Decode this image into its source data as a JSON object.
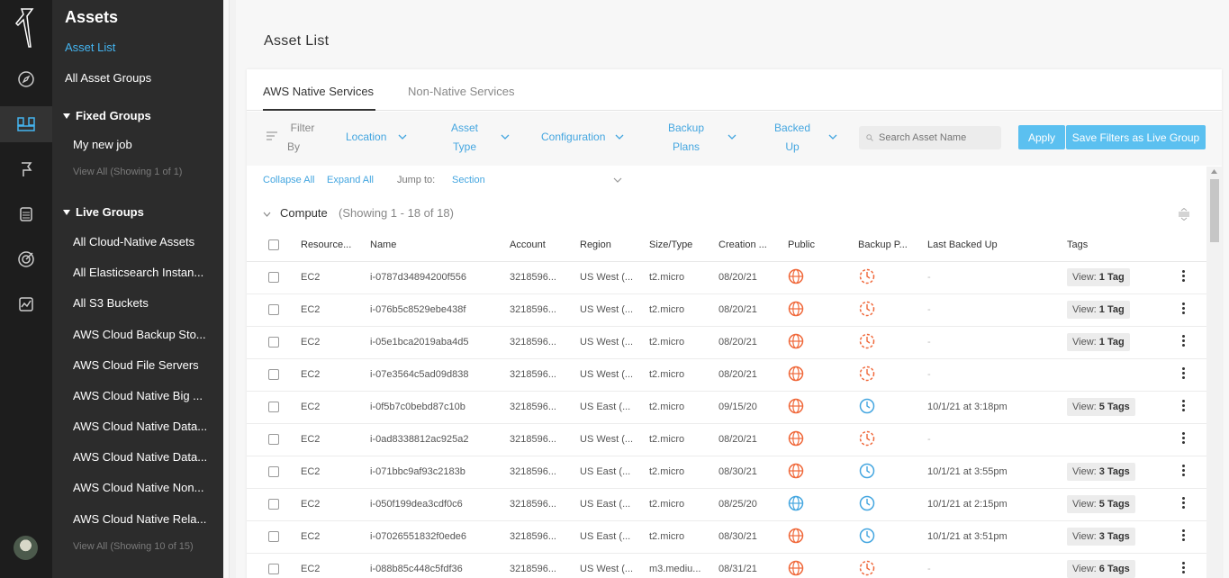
{
  "sidebar": {
    "title": "Assets",
    "nav": [
      "Asset List",
      "All Asset Groups"
    ],
    "fixed_groups": {
      "heading": "Fixed Groups",
      "items": [
        "My new job"
      ],
      "view_all": "View All (Showing 1 of 1)"
    },
    "live_groups": {
      "heading": "Live Groups",
      "items": [
        "All Cloud-Native Assets",
        "All Elasticsearch Instan...",
        "All S3 Buckets",
        "AWS Cloud Backup Sto...",
        "AWS Cloud File Servers",
        "AWS Cloud Native Big ...",
        "AWS Cloud Native Data...",
        "AWS Cloud Native Data...",
        "AWS Cloud Native Non...",
        "AWS Cloud Native Rela..."
      ],
      "view_all": "View All (Showing 10 of 15)"
    }
  },
  "rail_icons": [
    "logo-icon",
    "compass-icon",
    "assets-icon",
    "flag-icon",
    "database-icon",
    "target-icon",
    "chart-icon"
  ],
  "page_title": "Asset List",
  "tabs": [
    "AWS Native Services",
    "Non-Native Services"
  ],
  "filters": {
    "label": [
      "Filter",
      "By"
    ],
    "location": "Location",
    "asset_type": [
      "Asset",
      "Type"
    ],
    "configuration": "Configuration",
    "backup_plans": [
      "Backup",
      "Plans"
    ],
    "backed_up": [
      "Backed",
      "Up"
    ],
    "search_placeholder": "Search Asset Name",
    "apply": "Apply",
    "save_live_group": "Save Filters as Live Group"
  },
  "jump": {
    "collapse_all": "Collapse All",
    "expand_all": "Expand All",
    "jump_to": "Jump to:",
    "section": "Section"
  },
  "section": {
    "title": "Compute",
    "count": "(Showing 1 - 18 of 18)"
  },
  "table": {
    "columns": [
      "Resource...",
      "Name",
      "Account",
      "Region",
      "Size/Type",
      "Creation ...",
      "Public",
      "Backup P...",
      "Last Backed Up",
      "Tags"
    ],
    "rows": [
      {
        "resource": "EC2",
        "name": "i-0787d34894200f556",
        "account": "3218596...",
        "region": "US West (...",
        "size": "t2.micro",
        "created": "08/20/21",
        "public": "globe-orange",
        "backup": "clock-broken",
        "last": "-",
        "tag_prefix": "View:",
        "tag_count": "1 Tag"
      },
      {
        "resource": "EC2",
        "name": "i-076b5c8529ebe438f",
        "account": "3218596...",
        "region": "US West (...",
        "size": "t2.micro",
        "created": "08/20/21",
        "public": "globe-orange",
        "backup": "clock-broken",
        "last": "-",
        "tag_prefix": "View:",
        "tag_count": "1 Tag"
      },
      {
        "resource": "EC2",
        "name": "i-05e1bca2019aba4d5",
        "account": "3218596...",
        "region": "US West (...",
        "size": "t2.micro",
        "created": "08/20/21",
        "public": "globe-orange",
        "backup": "clock-broken",
        "last": "-",
        "tag_prefix": "View:",
        "tag_count": "1 Tag"
      },
      {
        "resource": "EC2",
        "name": "i-07e3564c5ad09d838",
        "account": "3218596...",
        "region": "US West (...",
        "size": "t2.micro",
        "created": "08/20/21",
        "public": "globe-orange",
        "backup": "clock-broken",
        "last": "-",
        "tag_prefix": "",
        "tag_count": ""
      },
      {
        "resource": "EC2",
        "name": "i-0f5b7c0bebd87c10b",
        "account": "3218596...",
        "region": "US East (...",
        "size": "t2.micro",
        "created": "09/15/20",
        "public": "globe-orange",
        "backup": "clock-blue",
        "last": "10/1/21 at 3:18pm",
        "tag_prefix": "View:",
        "tag_count": "5 Tags"
      },
      {
        "resource": "EC2",
        "name": "i-0ad8338812ac925a2",
        "account": "3218596...",
        "region": "US West (...",
        "size": "t2.micro",
        "created": "08/20/21",
        "public": "globe-orange",
        "backup": "clock-broken",
        "last": "-",
        "tag_prefix": "",
        "tag_count": ""
      },
      {
        "resource": "EC2",
        "name": "i-071bbc9af93c2183b",
        "account": "3218596...",
        "region": "US East (...",
        "size": "t2.micro",
        "created": "08/30/21",
        "public": "globe-orange",
        "backup": "clock-blue",
        "last": "10/1/21 at 3:55pm",
        "tag_prefix": "View:",
        "tag_count": "3 Tags"
      },
      {
        "resource": "EC2",
        "name": "i-050f199dea3cdf0c6",
        "account": "3218596...",
        "region": "US East (...",
        "size": "t2.micro",
        "created": "08/25/20",
        "public": "globe-blue",
        "backup": "clock-blue",
        "last": "10/1/21 at 2:15pm",
        "tag_prefix": "View:",
        "tag_count": "5 Tags"
      },
      {
        "resource": "EC2",
        "name": "i-07026551832f0ede6",
        "account": "3218596...",
        "region": "US East (...",
        "size": "t2.micro",
        "created": "08/30/21",
        "public": "globe-orange",
        "backup": "clock-blue",
        "last": "10/1/21 at 3:51pm",
        "tag_prefix": "View:",
        "tag_count": "3 Tags"
      },
      {
        "resource": "EC2",
        "name": "i-088b85c448c5fdf36",
        "account": "3218596...",
        "region": "US West (...",
        "size": "m3.mediu...",
        "created": "08/31/21",
        "public": "globe-orange",
        "backup": "clock-broken",
        "last": "-",
        "tag_prefix": "View:",
        "tag_count": "6 Tags"
      }
    ]
  },
  "colors": {
    "accent": "#44a6e0",
    "button": "#5bc0f0",
    "warn": "#f0683a",
    "rail": "#1d1d1d",
    "sidebar": "#2c2c2c"
  }
}
